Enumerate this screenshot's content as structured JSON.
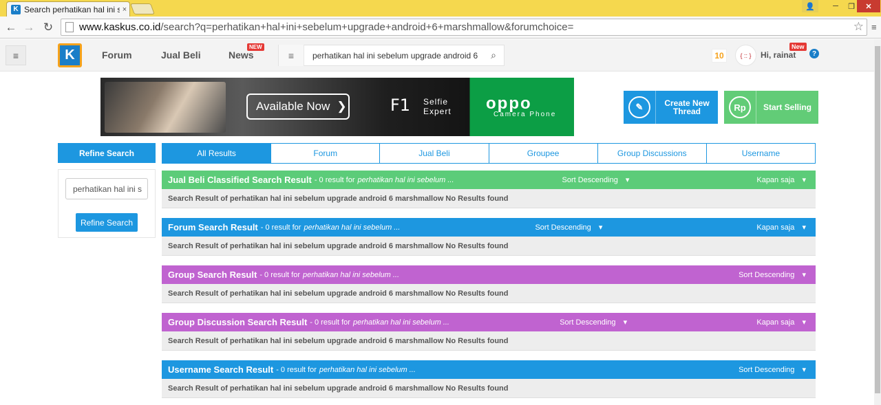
{
  "browser": {
    "tab_title": "Search perhatikan hal ini s",
    "tab_close": "×",
    "tab_favicon": "K",
    "url_host": "www.kaskus.co.id",
    "url_path": "/search?q=perhatikan+hal+ini+sebelum+upgrade+android+6+marshmallow&forumchoice=",
    "back_icon": "←",
    "forward_icon": "→",
    "reload_icon": "↻",
    "star_icon": "☆",
    "menu_icon": "≡",
    "win_user": "👤",
    "win_min": "─",
    "win_max": "❐",
    "win_close": "✕"
  },
  "header": {
    "menu_icon": "≡",
    "logo_text": "K",
    "nav": [
      {
        "label": "Forum"
      },
      {
        "label": "Jual Beli"
      },
      {
        "label": "News",
        "badge": "NEW"
      }
    ],
    "search_query": "perhatikan hal ini sebelum upgrade android 6",
    "search_lines_icon": "≡",
    "search_icon": "⌕",
    "notif_count": "10",
    "avatar_text": "{ :: }",
    "greeting": "Hi, rainat",
    "greeting_badge": "New",
    "help_icon": "?"
  },
  "banner": {
    "cta": "Available Now",
    "cta_arrow": "❯",
    "model": "F1",
    "tagline_1": "Selfie",
    "tagline_2": "Expert",
    "brand": "oppo",
    "brand_sub": "Camera Phone"
  },
  "actions": {
    "create_thread": "Create New Thread",
    "create_thread_icon": "✎",
    "start_selling": "Start Selling",
    "start_selling_icon": "Rp"
  },
  "sidebar": {
    "title": "Refine Search",
    "input_value": "perhatikan hal ini s",
    "button": "Refine Search"
  },
  "tabs": [
    {
      "label": "All Results",
      "active": true
    },
    {
      "label": "Forum"
    },
    {
      "label": "Jual Beli"
    },
    {
      "label": "Groupee"
    },
    {
      "label": "Group Discussions"
    },
    {
      "label": "Username"
    }
  ],
  "sections": [
    {
      "name": "Jual Beli Classified Search Result",
      "count": "- 0 result for",
      "query": "perhatikan hal ini sebelum ...",
      "sort": "Sort Descending",
      "time": "Kapan saja",
      "message": "Search Result of perhatikan hal ini sebelum upgrade android 6 marshmallow No Results found",
      "color": "#5ccc79"
    },
    {
      "name": "Forum Search Result",
      "count": "- 0 result for",
      "query": "perhatikan hal ini sebelum ...",
      "sort": "Sort Descending",
      "time": "Kapan saja",
      "message": "Search Result of perhatikan hal ini sebelum upgrade android 6 marshmallow No Results found",
      "color": "#1d97e0"
    },
    {
      "name": "Group Search Result",
      "count": "- 0 result for",
      "query": "perhatikan hal ini sebelum ...",
      "sort": "Sort Descending",
      "message": "Search Result of perhatikan hal ini sebelum upgrade android 6 marshmallow No Results found",
      "color": "#c063d0"
    },
    {
      "name": "Group Discussion Search Result",
      "count": "- 0 result for",
      "query": "perhatikan hal ini sebelum ...",
      "sort": "Sort Descending",
      "time": "Kapan saja",
      "message": "Search Result of perhatikan hal ini sebelum upgrade android 6 marshmallow No Results found",
      "color": "#c063d0"
    },
    {
      "name": "Username Search Result",
      "count": "- 0 result for",
      "query": "perhatikan hal ini sebelum ...",
      "sort": "Sort Descending",
      "message": "Search Result of perhatikan hal ini sebelum upgrade android 6 marshmallow No Results found",
      "color": "#1d97e0"
    }
  ],
  "dropdown_caret": "▾"
}
